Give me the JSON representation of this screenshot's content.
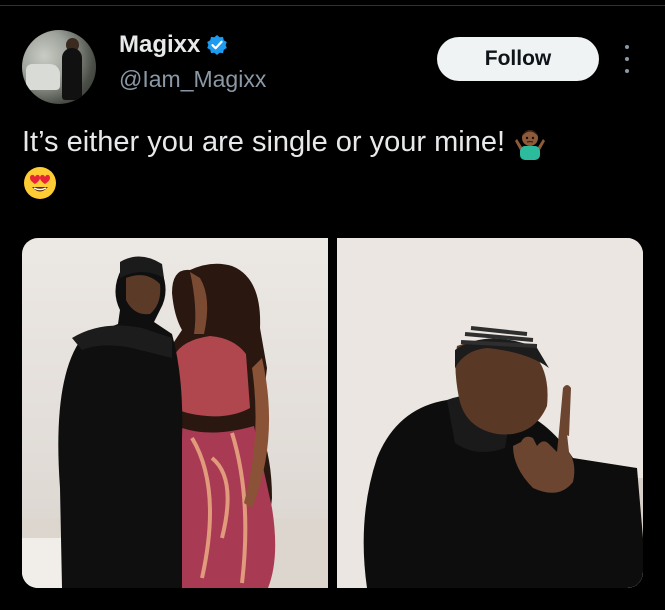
{
  "tweet": {
    "display_name": "Magixx",
    "handle": "@Iam_Magixx",
    "verified": true,
    "follow_label": "Follow",
    "text": "It’s either you are single or your mine!",
    "emojis": [
      "person-shrugging-emoji",
      "heart-eyes-emoji"
    ],
    "accent_color": "#1d9bf0"
  },
  "media": {
    "count": 2,
    "items": [
      "couple-photo",
      "man-hand-sign-photo"
    ]
  }
}
